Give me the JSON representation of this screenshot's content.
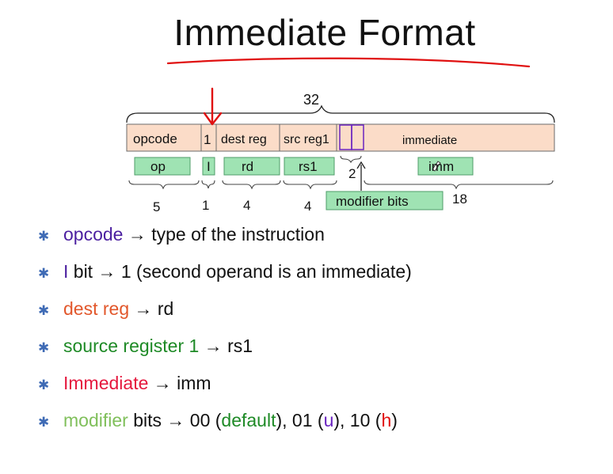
{
  "title": "Immediate Format",
  "diagram": {
    "total_bits": "32",
    "fields": [
      "opcode",
      "1",
      "dest reg",
      "src reg1",
      "immediate"
    ],
    "abbrevs": [
      "op",
      "I",
      "rd",
      "rs1",
      "imm"
    ],
    "widths": [
      "5",
      "1",
      "4",
      "4",
      "18"
    ],
    "modifier_label": "modifier bits",
    "modifier_width": "2"
  },
  "bullets": [
    {
      "key": "opcode",
      "key_color": "#4b1fa0",
      "rest": " → type of the instruction"
    },
    {
      "key": "I",
      "key_color": "#4b1fa0",
      "rest": " bit → 1 (second operand is an immediate)"
    },
    {
      "key": "dest reg",
      "key_color": "#e2572b",
      "rest": " → rd"
    },
    {
      "key": "source register 1",
      "key_color": "#1e8a26",
      "rest": " → rs1"
    },
    {
      "key": "Immediate",
      "key_color": "#e5183e",
      "rest": " → imm"
    },
    {
      "key": "modifier",
      "key_color": "#7fbf5a",
      "rest": " bits → 00 (",
      "d": "default",
      "d_color": "#1e8a26",
      "mid1": "), 01 (",
      "u": "u",
      "u_color": "#6a24c0",
      "mid2": "), 10 (",
      "h": "h",
      "h_color": "#e01010",
      "end": ")"
    }
  ],
  "colors": {
    "field_fill": "#fbdcc8",
    "abbrev_fill": "#9fe3b3",
    "annotation_red": "#e01010",
    "modifier_outline": "#6a24c0"
  }
}
